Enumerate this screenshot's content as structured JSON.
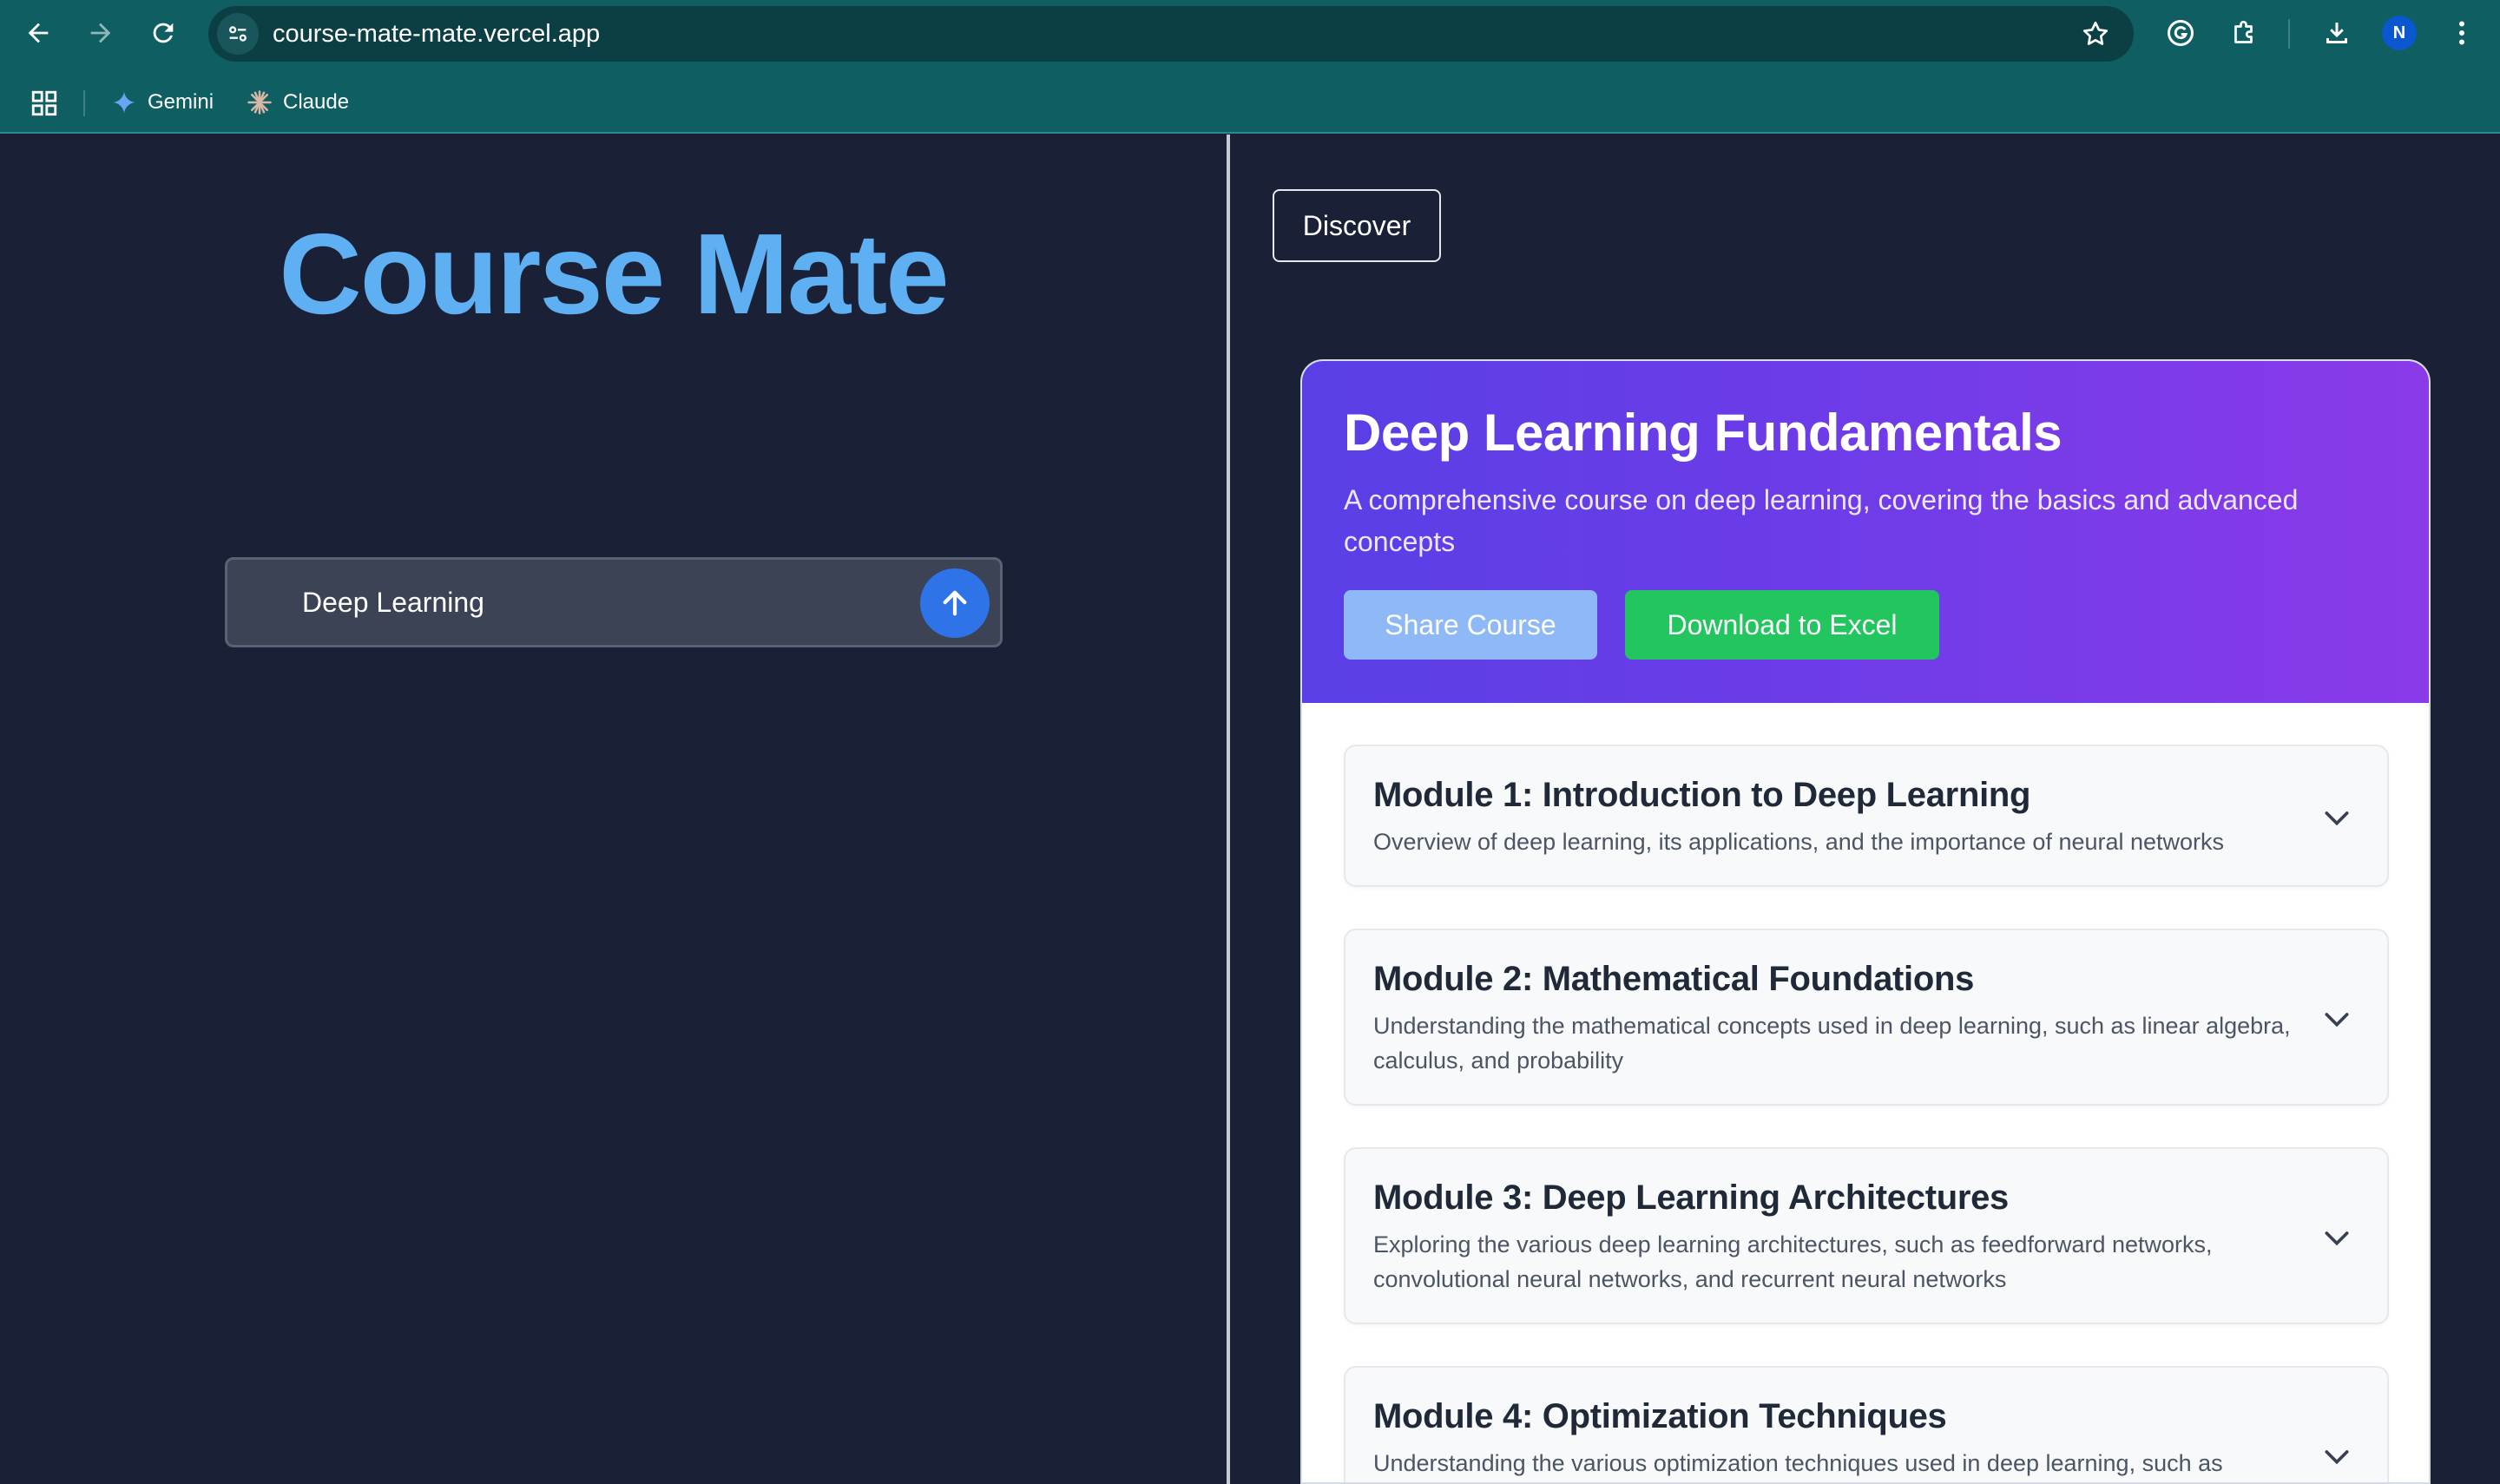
{
  "browser": {
    "url": "course-mate-mate.vercel.app",
    "avatar_initial": "N",
    "bookmarks": [
      {
        "label": "Gemini"
      },
      {
        "label": "Claude"
      }
    ]
  },
  "app": {
    "title": "Course Mate",
    "search_value": "Deep Learning",
    "discover_label": "Discover"
  },
  "course": {
    "title": "Deep Learning Fundamentals",
    "description": "A comprehensive course on deep learning, covering the basics and advanced concepts",
    "share_label": "Share Course",
    "download_label": "Download to Excel",
    "modules": [
      {
        "title": "Module 1: Introduction to Deep Learning",
        "description": "Overview of deep learning, its applications, and the importance of neural networks"
      },
      {
        "title": "Module 2: Mathematical Foundations",
        "description": "Understanding the mathematical concepts used in deep learning, such as linear algebra, calculus, and probability"
      },
      {
        "title": "Module 3: Deep Learning Architectures",
        "description": "Exploring the various deep learning architectures, such as feedforward networks, convolutional neural networks, and recurrent neural networks"
      },
      {
        "title": "Module 4: Optimization Techniques",
        "description": "Understanding the various optimization techniques used in deep learning, such as"
      }
    ]
  },
  "colors": {
    "chrome": "#0f5e61",
    "background": "#1a2036",
    "title_blue": "#5eb0f2",
    "header_gradient_start": "#5a3fe6",
    "header_gradient_end": "#8b3ae8",
    "excel_green": "#22c55e",
    "share_blue": "#8fb9f6"
  }
}
